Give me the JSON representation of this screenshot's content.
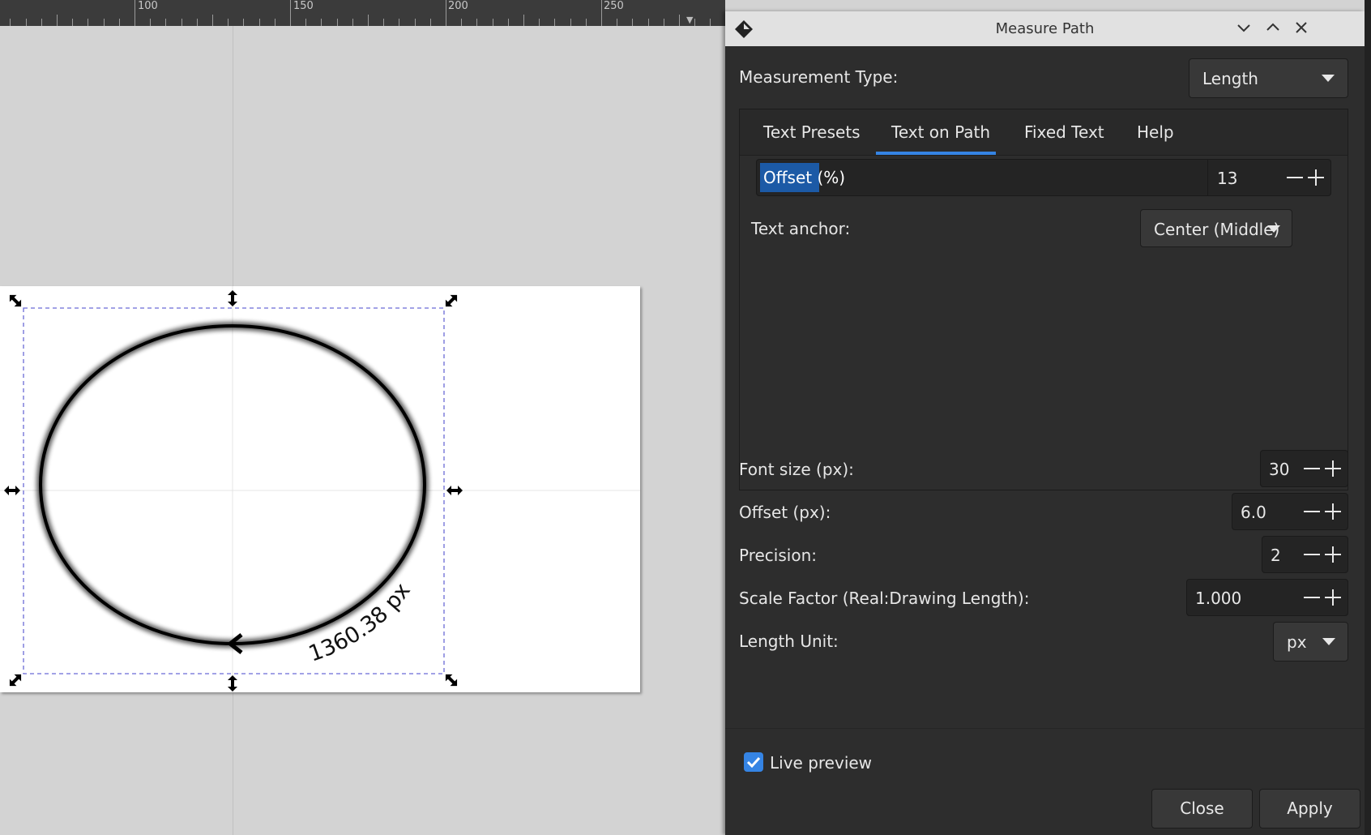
{
  "ruler": {
    "labels": [
      "100",
      "150",
      "200",
      "250"
    ]
  },
  "canvas": {
    "measure_label": "1360.38 px"
  },
  "dialog": {
    "title": "Measure Path",
    "measurement_type": {
      "label": "Measurement Type:",
      "value": "Length"
    },
    "tabs": [
      {
        "label": "Text Presets",
        "active": false
      },
      {
        "label": "Text on Path",
        "active": true
      },
      {
        "label": "Fixed Text",
        "active": false
      },
      {
        "label": "Help",
        "active": false
      }
    ],
    "text_on_path": {
      "offset_pct": {
        "label": "Offset (%)",
        "value": "13"
      },
      "text_anchor": {
        "label": "Text anchor:",
        "value": "Center (Middle)"
      }
    },
    "font_size": {
      "label": "Font size (px):",
      "value": "30"
    },
    "offset_px": {
      "label": "Offset (px):",
      "value": "6.0"
    },
    "precision": {
      "label": "Precision:",
      "value": "2"
    },
    "scale_factor": {
      "label": "Scale Factor (Real:Drawing Length):",
      "value": "1.000"
    },
    "length_unit": {
      "label": "Length Unit:",
      "value": "px"
    },
    "live_preview": {
      "label": "Live preview",
      "checked": true
    },
    "buttons": {
      "close": "Close",
      "apply": "Apply"
    }
  },
  "colors": {
    "accent": "#3584e4",
    "dialog_bg": "#2d2d2d",
    "canvas_bg": "#d3d3d3",
    "selection": "#6b6bd6"
  }
}
